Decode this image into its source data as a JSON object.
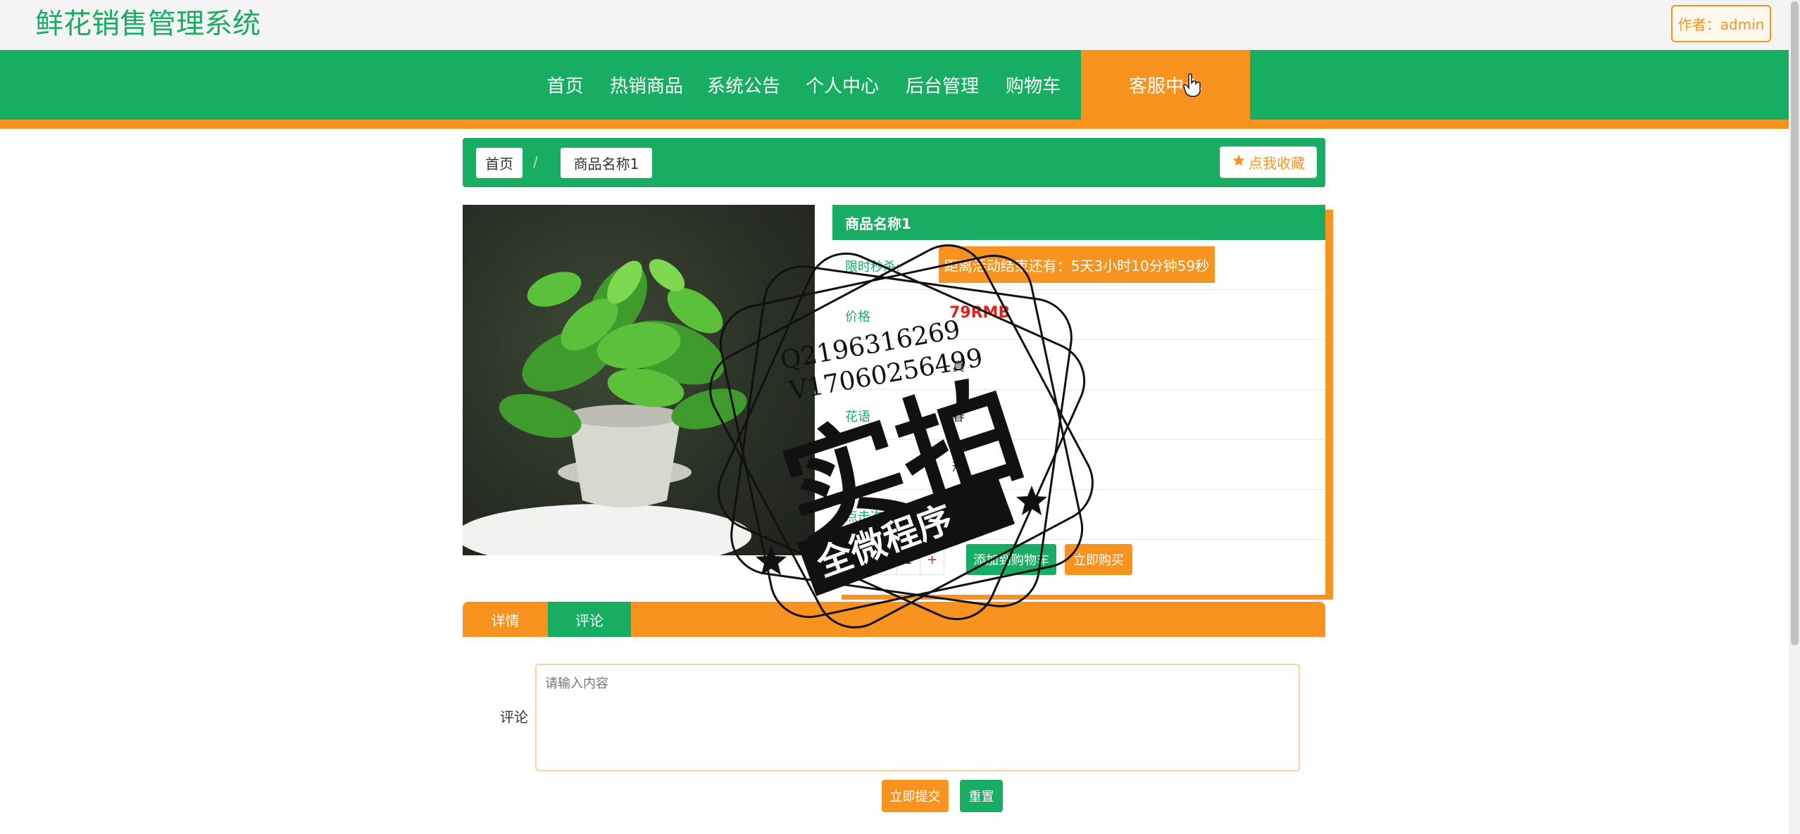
{
  "header": {
    "site_title": "鲜花销售管理系统",
    "author": "作者：admin"
  },
  "nav": {
    "items": [
      "首页",
      "热销商品",
      "系统公告",
      "个人中心",
      "后台管理",
      "购物车",
      "客服中心"
    ],
    "active": "客服中心"
  },
  "breadcrumb": {
    "home": "首页",
    "separator": "/",
    "current": "商品名称1",
    "favorite_label": "点我收藏",
    "favorite_icon": "star-icon"
  },
  "product": {
    "image_icon": "potted-plant-image",
    "name": "商品名称1",
    "rows": [
      {
        "label": "限时秒杀:",
        "value": "距离活动结束还有：5天3小时10分钟59秒"
      },
      {
        "label": "价格",
        "value": "79RMB"
      },
      {
        "label": "",
        "value": "真"
      },
      {
        "label": "花语",
        "value": "春"
      },
      {
        "label": "",
        "value": "规"
      },
      {
        "label": "点击次数",
        "value": ""
      }
    ],
    "quantity": {
      "minus": "-",
      "value": "1",
      "plus": "+"
    },
    "add_to_cart": "添加到购物车",
    "buy_now": "立即购买"
  },
  "tabs": {
    "detail": "详情",
    "comment": "评论",
    "active": "评论"
  },
  "comment_form": {
    "label": "评论",
    "placeholder": "请输入内容",
    "submit": "立即提交",
    "reset": "重置"
  },
  "watermark": {
    "line1": "Q2196316269",
    "line2": "V17060256499",
    "big": "实拍",
    "banner": "全微程序"
  },
  "colors": {
    "primary_green": "#17ad63",
    "accent_orange": "#f7931e",
    "price_red": "#e0211c"
  }
}
